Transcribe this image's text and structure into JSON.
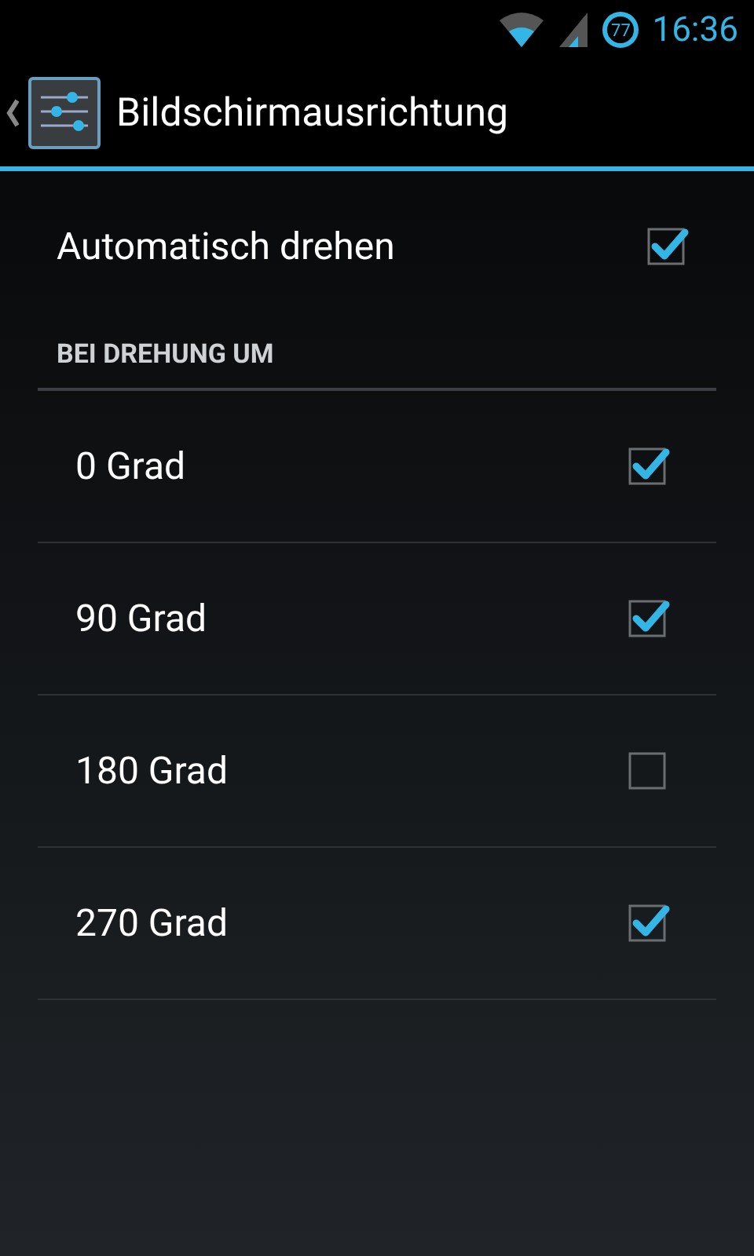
{
  "status_bar": {
    "battery_level_text": "77",
    "time": "16:36"
  },
  "action_bar": {
    "title": "Bildschirmausrichtung"
  },
  "auto_rotate": {
    "label": "Automatisch drehen",
    "checked": true
  },
  "section": {
    "title": "BEI DREHUNG UM"
  },
  "options": [
    {
      "label": "0 Grad",
      "checked": true
    },
    {
      "label": "90 Grad",
      "checked": true
    },
    {
      "label": "180 Grad",
      "checked": false
    },
    {
      "label": "270 Grad",
      "checked": true
    }
  ]
}
